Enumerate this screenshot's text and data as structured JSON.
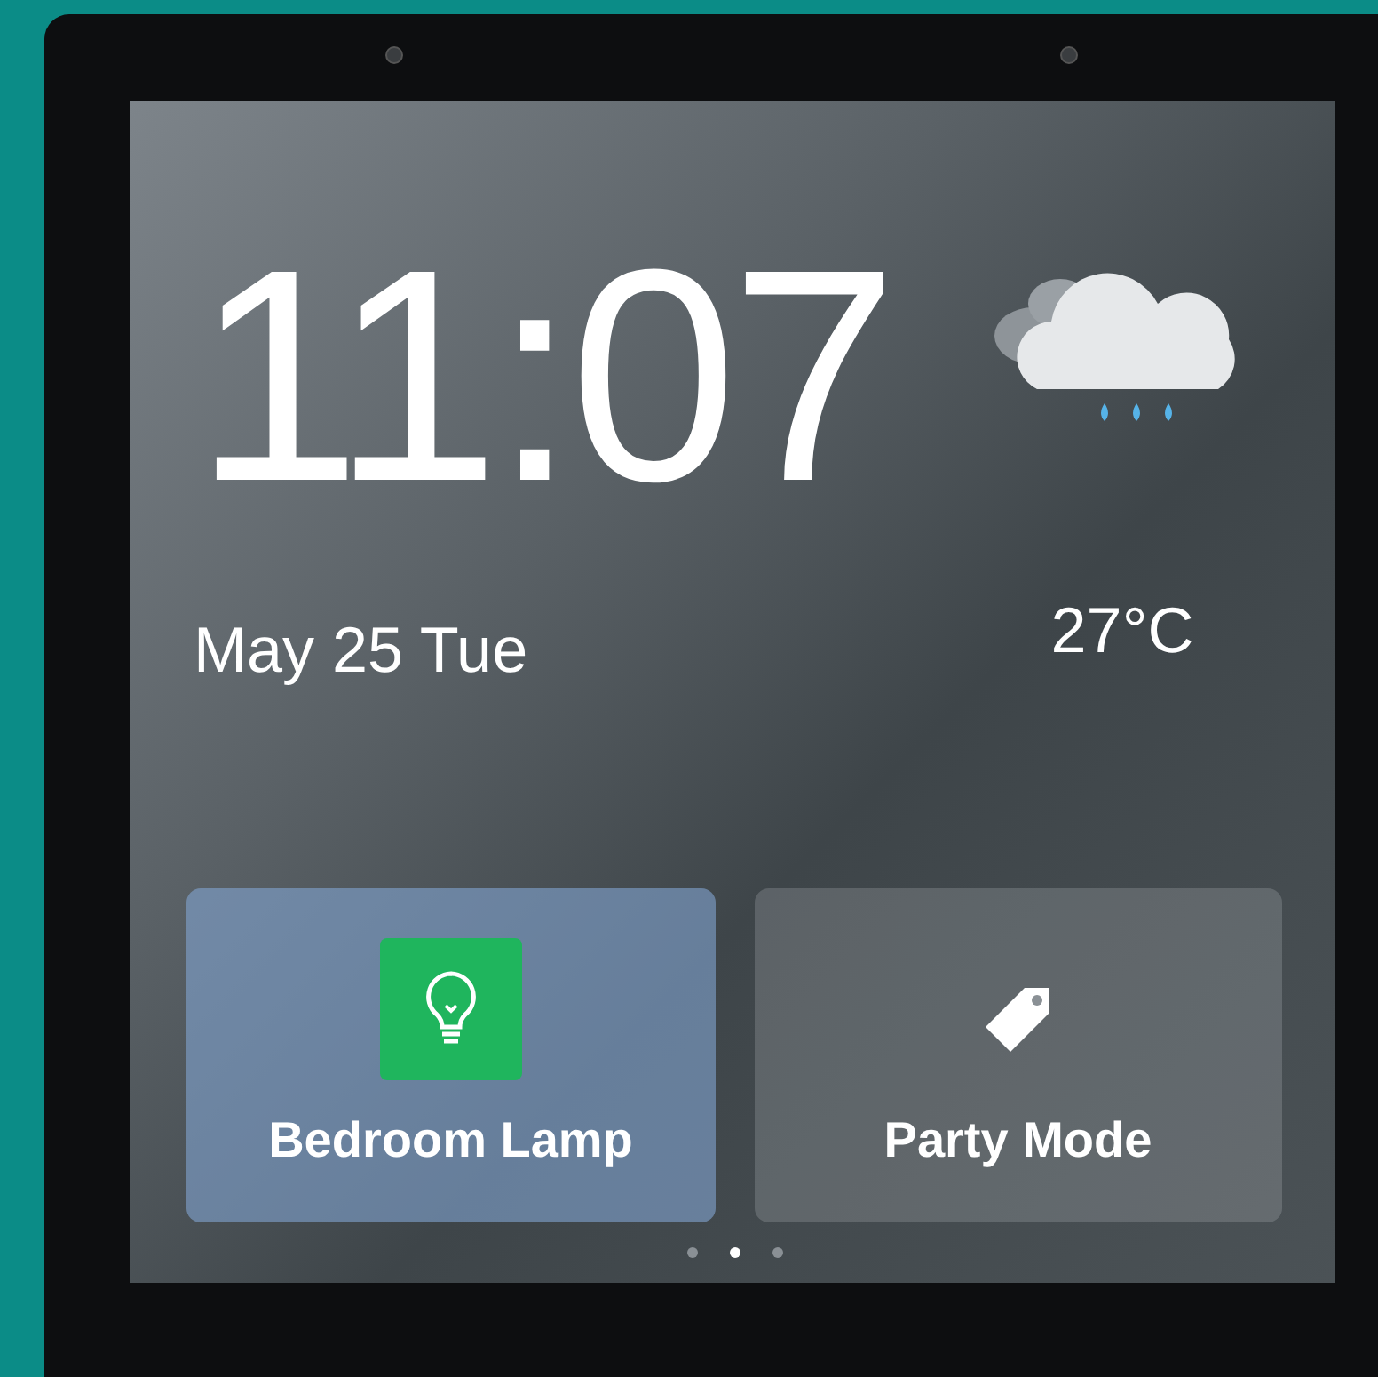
{
  "clock": {
    "time": "11:07",
    "date": "May 25 Tue"
  },
  "weather": {
    "temperature": "27°C"
  },
  "tiles": [
    {
      "label": "Bedroom Lamp",
      "kind": "lamp",
      "on": true
    },
    {
      "label": "Party Mode",
      "kind": "tag",
      "on": false
    }
  ],
  "pager": [
    {
      "selected": false
    },
    {
      "selected": true
    },
    {
      "selected": false
    }
  ]
}
